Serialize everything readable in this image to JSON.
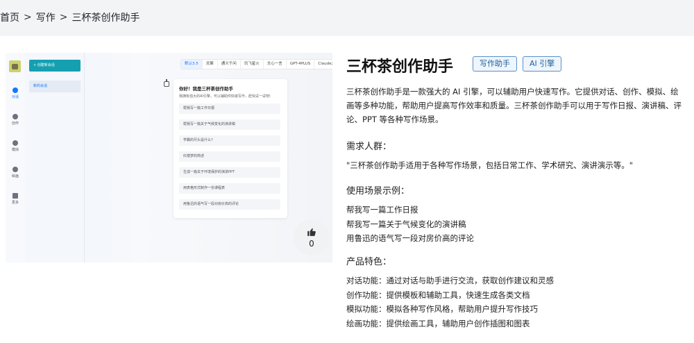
{
  "breadcrumb": {
    "home": "首页",
    "category": "写作",
    "current": "三杯茶创作助手",
    "separator": ">"
  },
  "preview": {
    "nav": [
      {
        "label": "对话",
        "active": true
      },
      {
        "label": "创作",
        "active": false
      },
      {
        "label": "模拟",
        "active": false
      },
      {
        "label": "绘画",
        "active": false
      },
      {
        "label": "更多",
        "active": false
      }
    ],
    "new_chat_label": "+ 创建新会话",
    "conversation_label": "新的会话",
    "model_tabs": [
      "默认3.5",
      "灵犀",
      "通义千问",
      "讯飞星火",
      "文心一言",
      "GPT-4PLUS",
      "Claude2"
    ],
    "greeting": "你好！我是三杯茶创作助手",
    "greeting_desc": "我拥有强大的AI引擎，可以辅助你快速写作，赶快试一试吧!",
    "suggestions": [
      "帮我写一篇工作日报",
      "帮我写一篇关于气候变化的演讲稿",
      "学霸的尽头是什么?",
      "红楼梦的简述",
      "生成一篇关于环境保护的演讲PPT",
      "用表格形式制作一份课程表",
      "用鲁迅的语气写一段对房价高的评论"
    ]
  },
  "likes": {
    "count": "0",
    "icon": "thumbs-up-icon"
  },
  "detail": {
    "title": "三杯茶创作助手",
    "tags": [
      "写作助手",
      "AI 引擎"
    ],
    "description": "三杯茶创作助手是一款强大的 AI 引擎，可以辅助用户快速写作。它提供对话、创作、模拟、绘画等多种功能，帮助用户提高写作效率和质量。三杯茶创作助手可以用于写作日报、演讲稿、评论、PPT 等各种写作场景。",
    "audience_heading": "需求人群：",
    "audience_text": "\"三杯茶创作助手适用于各种写作场景，包括日常工作、学术研究、演讲演示等。\"",
    "examples_heading": "使用场景示例：",
    "examples": [
      "帮我写一篇工作日报",
      "帮我写一篇关于气候变化的演讲稿",
      "用鲁迅的语气写一段对房价高的评论"
    ],
    "features_heading": "产品特色：",
    "features": [
      "对话功能：通过对话与助手进行交流，获取创作建议和灵感",
      "创作功能：提供模板和辅助工具，快速生成各类文档",
      "模拟功能：模拟各种写作风格，帮助用户提升写作技巧",
      "绘画功能：提供绘画工具，辅助用户创作插图和图表"
    ]
  },
  "colors": {
    "accent": "#1677ff",
    "tag_border": "#5b8fc7",
    "new_button": "#14a0b0"
  }
}
